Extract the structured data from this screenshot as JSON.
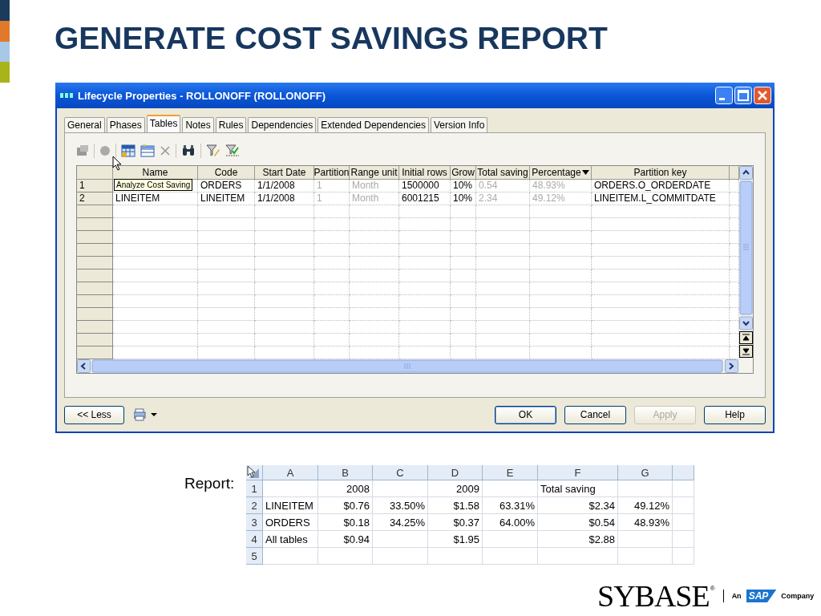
{
  "slide": {
    "title": "GENERATE COST SAVINGS REPORT"
  },
  "dialog": {
    "title": "Lifecycle Properties - ROLLONOFF (ROLLONOFF)",
    "tabs": [
      {
        "label": "General",
        "selected": false
      },
      {
        "label": "Phases",
        "selected": false
      },
      {
        "label": "Tables",
        "selected": true
      },
      {
        "label": "Notes",
        "selected": false
      },
      {
        "label": "Rules",
        "selected": false
      },
      {
        "label": "Dependencies",
        "selected": false
      },
      {
        "label": "Extended Dependencies",
        "selected": false
      },
      {
        "label": "Version Info",
        "selected": false
      }
    ],
    "tooltip": "Analyze Cost Saving",
    "grid": {
      "columns": [
        {
          "label": "Name",
          "readonly": false,
          "sorted": false
        },
        {
          "label": "Code",
          "readonly": false,
          "sorted": false
        },
        {
          "label": "Start Date",
          "readonly": false,
          "sorted": false
        },
        {
          "label": "Partition",
          "readonly": true,
          "sorted": false
        },
        {
          "label": "Range unit",
          "readonly": true,
          "sorted": false
        },
        {
          "label": "Initial rows",
          "readonly": false,
          "sorted": false
        },
        {
          "label": "Grow",
          "readonly": false,
          "sorted": false
        },
        {
          "label": "Total saving",
          "readonly": true,
          "sorted": false
        },
        {
          "label": "Percentage",
          "readonly": true,
          "sorted": true
        },
        {
          "label": "Partition key",
          "readonly": false,
          "sorted": false
        }
      ],
      "rows": [
        {
          "number": "1",
          "cells": [
            null,
            "ORDERS",
            "1/1/2008",
            "1",
            "Month",
            "1500000",
            "10%",
            "0.54",
            "48.93%",
            "ORDERS.O_ORDERDATE"
          ]
        },
        {
          "number": "2",
          "cells": [
            "LINEITEM",
            "LINEITEM",
            "1/1/2008",
            "1",
            "Month",
            "6001215",
            "10%",
            "2.34",
            "49.12%",
            "LINEITEM.L_COMMITDATE"
          ]
        }
      ]
    },
    "buttons": [
      {
        "label": "<< Less",
        "kind": "push",
        "disabled": false,
        "default": false
      },
      {
        "kind": "print-menu"
      },
      {
        "label": "OK",
        "kind": "push",
        "disabled": false,
        "default": true
      },
      {
        "label": "Cancel",
        "kind": "push",
        "disabled": false,
        "default": false
      },
      {
        "label": "Apply",
        "kind": "push",
        "disabled": true,
        "default": false
      },
      {
        "label": "Help",
        "kind": "push",
        "disabled": false,
        "default": false
      }
    ]
  },
  "report": {
    "label": "Report:",
    "columns": [
      "A",
      "B",
      "C",
      "D",
      "E",
      "F",
      "G"
    ],
    "rows": [
      {
        "number": "1",
        "cells": [
          null,
          {
            "text": "2008",
            "kind": "number"
          },
          null,
          {
            "text": "2009",
            "kind": "number"
          },
          null,
          {
            "text": "Total saving",
            "kind": "label"
          },
          null
        ]
      },
      {
        "number": "2",
        "cells": [
          {
            "text": "LINEITEM",
            "kind": "label"
          },
          {
            "text": "$0.76",
            "kind": "number"
          },
          {
            "text": "33.50%",
            "kind": "number"
          },
          {
            "text": "$1.58",
            "kind": "number"
          },
          {
            "text": "63.31%",
            "kind": "number"
          },
          {
            "text": "$2.34",
            "kind": "number"
          },
          {
            "text": "49.12%",
            "kind": "number"
          }
        ]
      },
      {
        "number": "3",
        "cells": [
          {
            "text": "ORDERS",
            "kind": "label"
          },
          {
            "text": "$0.18",
            "kind": "number"
          },
          {
            "text": "34.25%",
            "kind": "number"
          },
          {
            "text": "$0.37",
            "kind": "number"
          },
          {
            "text": "64.00%",
            "kind": "number"
          },
          {
            "text": "$0.54",
            "kind": "number"
          },
          {
            "text": "48.93%",
            "kind": "number"
          }
        ]
      },
      {
        "number": "4",
        "cells": [
          {
            "text": "All tables",
            "kind": "label"
          },
          {
            "text": "$0.94",
            "kind": "number"
          },
          null,
          {
            "text": "$1.95",
            "kind": "number"
          },
          null,
          {
            "text": "$2.88",
            "kind": "number"
          },
          null
        ]
      },
      {
        "number": "5"
      }
    ]
  },
  "logo": {
    "brand": "SYBASE",
    "mark": "®",
    "prefix": "An",
    "partner": "SAP",
    "suffix": "Company"
  }
}
